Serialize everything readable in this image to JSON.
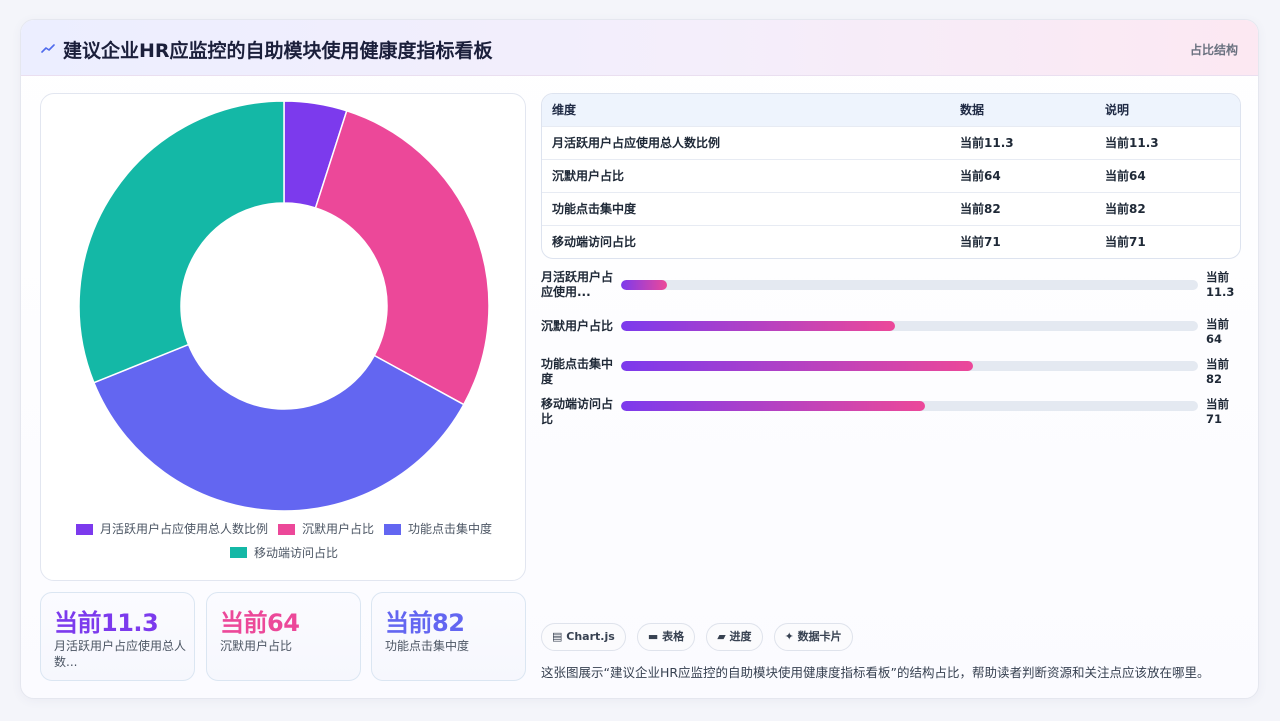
{
  "header": {
    "title": "建议企业HR应监控的自助模块使用健康度指标看板",
    "tag": "占比结构"
  },
  "colors": {
    "purple": "#7c3aed",
    "pink": "#ec4899",
    "indigo": "#6366f1",
    "teal": "#14b8a6"
  },
  "chart_data": {
    "type": "pie",
    "categories": [
      "月活跃用户占应使用总人数比例",
      "沉默用户占比",
      "功能点击集中度",
      "移动端访问占比"
    ],
    "values": [
      11.3,
      64,
      82,
      71
    ],
    "colors": [
      "#7c3aed",
      "#ec4899",
      "#6366f1",
      "#14b8a6"
    ],
    "title": "",
    "legend_position": "bottom"
  },
  "kpis": [
    {
      "value": "当前11.3",
      "label": "月活跃用户占应使用总人数...",
      "color": "#7c3aed"
    },
    {
      "value": "当前64",
      "label": "沉默用户占比",
      "color": "#ec4899"
    },
    {
      "value": "当前82",
      "label": "功能点击集中度",
      "color": "#6366f1"
    }
  ],
  "table": {
    "headers": [
      "维度",
      "数据",
      "说明"
    ],
    "rows": [
      [
        "月活跃用户占应使用总人数比例",
        "当前11.3",
        "当前11.3"
      ],
      [
        "沉默用户占比",
        "当前64",
        "当前64"
      ],
      [
        "功能点击集中度",
        "当前82",
        "当前82"
      ],
      [
        "移动端访问占比",
        "当前71",
        "当前71"
      ]
    ]
  },
  "progress": [
    {
      "label": "月活跃用户占应使用...",
      "value": "当前11.3",
      "pct": 0.08
    },
    {
      "label": "沉默用户占比",
      "value": "当前64",
      "pct": 0.475
    },
    {
      "label": "功能点击集中度",
      "value": "当前82",
      "pct": 0.61
    },
    {
      "label": "移动端访问占比",
      "value": "当前71",
      "pct": 0.527
    }
  ],
  "chips": [
    {
      "icon": "chart-icon",
      "label": "Chart.js"
    },
    {
      "icon": "table-icon",
      "label": "表格"
    },
    {
      "icon": "progress-icon",
      "label": "进度"
    },
    {
      "icon": "sparkle-icon",
      "label": "数据卡片"
    }
  ],
  "description": "这张图展示“建议企业HR应监控的自助模块使用健康度指标看板”的结构占比，帮助读者判断资源和关注点应该放在哪里。"
}
